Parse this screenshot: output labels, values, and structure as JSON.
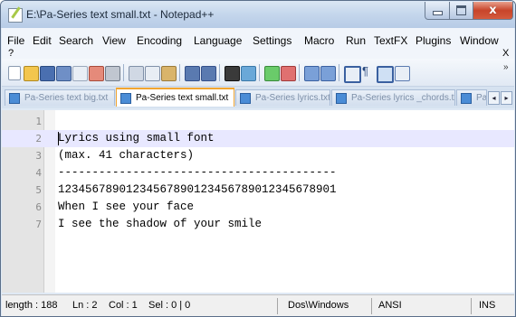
{
  "window": {
    "title": "E:\\Pa-Series text small.txt - Notepad++",
    "controls": {
      "close": "x"
    }
  },
  "menu": {
    "items": [
      "File",
      "Edit",
      "Search",
      "View",
      "Encoding",
      "Language",
      "Settings",
      "Macro",
      "Run",
      "TextFX",
      "Plugins",
      "Window"
    ],
    "help": "?",
    "close": "X"
  },
  "toolbar": {
    "more": "»",
    "icons": [
      "new-file-icon",
      "open-file-icon",
      "save-icon",
      "save-all-icon",
      "close-icon",
      "close-all-icon",
      "print-icon",
      "cut-icon",
      "copy-icon",
      "paste-icon",
      "undo-icon",
      "redo-icon",
      "find-icon",
      "replace-icon",
      "zoom-in-icon",
      "zoom-out-icon",
      "sync-vertical-icon",
      "sync-horizontal-icon",
      "word-wrap-icon",
      "show-all-chars-icon",
      "indent-guide-icon",
      "doc-map-icon"
    ]
  },
  "tabs": [
    {
      "label": "Pa-Series text big.txt",
      "active": false
    },
    {
      "label": "Pa-Series text small.txt",
      "active": true
    },
    {
      "label": "Pa-Series lyrics.txt",
      "active": false
    },
    {
      "label": "Pa-Series lyrics _chords.txt",
      "active": false
    },
    {
      "label": "Pa",
      "active": false
    }
  ],
  "tab_arrows": {
    "left": "◂",
    "right": "▸"
  },
  "editor": {
    "current_line": 2,
    "lines": [
      {
        "num": "1",
        "text": ""
      },
      {
        "num": "2",
        "text": "Lyrics using small font"
      },
      {
        "num": "3",
        "text": "(max. 41 characters)"
      },
      {
        "num": "4",
        "text": "-----------------------------------------"
      },
      {
        "num": "5",
        "text": "12345678901234567890123456789012345678901"
      },
      {
        "num": "6",
        "text": "When I see your face"
      },
      {
        "num": "7",
        "text": "I see the shadow of your smile"
      }
    ]
  },
  "status": {
    "length": "length : 188",
    "ln": "Ln : 2",
    "col": "Col : 1",
    "sel": "Sel : 0 | 0",
    "eol": "Dos\\Windows",
    "encoding": "ANSI",
    "mode": "INS"
  }
}
